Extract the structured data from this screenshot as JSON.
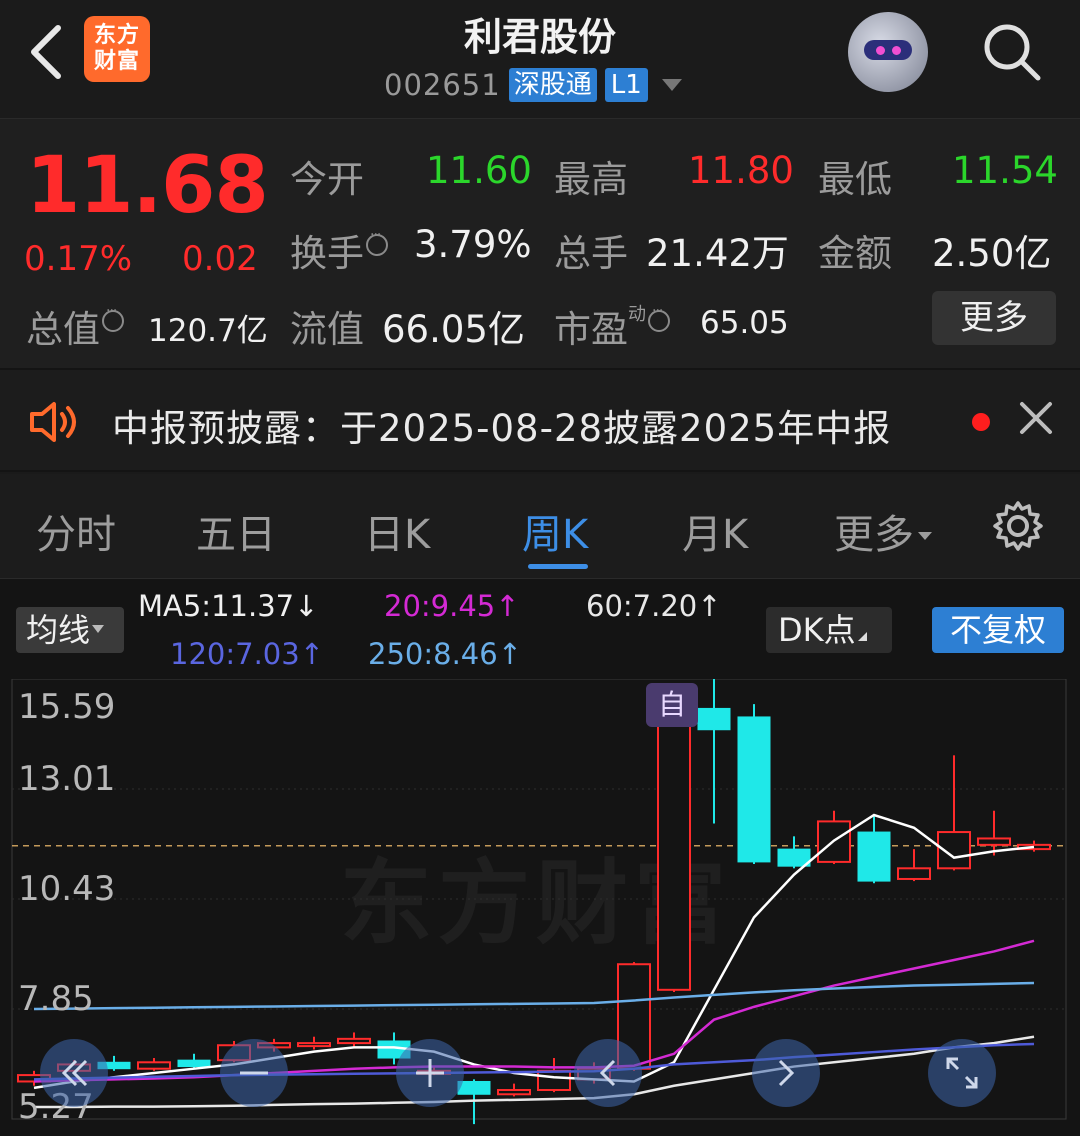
{
  "header": {
    "logo_text_line1": "东方",
    "logo_text_line2": "财富",
    "stock_name": "利君股份",
    "stock_code": "002651",
    "tag_connect": "深股通",
    "tag_level": "L1"
  },
  "quote": {
    "price": "11.68",
    "change_pct": "0.17%",
    "change_amt": "0.02",
    "open_label": "今开",
    "open_value": "11.60",
    "high_label": "最高",
    "high_value": "11.80",
    "low_label": "最低",
    "low_value": "11.54",
    "turnover_label": "换手",
    "turnover_value": "3.79%",
    "volume_label": "总手",
    "volume_value": "21.42万",
    "amount_label": "金额",
    "amount_value": "2.50亿",
    "mktcap_label": "总值",
    "mktcap_value": "120.7亿",
    "float_label": "流值",
    "float_value": "66.05亿",
    "pe_label": "市盈",
    "pe_sup": "动",
    "pe_value": "65.05",
    "more_label": "更多"
  },
  "notice": {
    "text": "中报预披露：于2025-08-28披露2025年中报"
  },
  "tabs": {
    "t1": "分时",
    "t2": "五日",
    "t3": "日K",
    "t4": "周K",
    "t5": "月K",
    "t6": "更多",
    "active": "周K"
  },
  "chart_controls": {
    "ma_button": "均线",
    "ma5": "MA5:11.37↓",
    "ma20": "20:9.45↑",
    "ma60": "60:7.20↑",
    "ma120": "120:7.03↑",
    "ma250": "250:8.46↑",
    "dk_button": "DK点",
    "adjust_button": "不复权",
    "self_marker": "自",
    "watermark": "东方财富"
  },
  "colors": {
    "up": "#ff2b2b",
    "down": "#1fe8e8",
    "ma5": "#ffffff",
    "ma20": "#d42ad4",
    "ma60": "#e8e8e8",
    "ma120": "#4e5ad8",
    "ma250": "#6aaee8",
    "accent": "#2d7fd3"
  },
  "chart_data": {
    "type": "candlestick",
    "y_ticks": [
      "15.59",
      "13.01",
      "10.43",
      "7.85",
      "5.27"
    ],
    "ylim": [
      5.27,
      15.59
    ],
    "current_price_line": 11.68,
    "candles": [
      {
        "o": 6.15,
        "c": 6.3,
        "h": 6.4,
        "l": 6.05
      },
      {
        "o": 6.4,
        "c": 6.55,
        "h": 6.65,
        "l": 6.35
      },
      {
        "o": 6.6,
        "c": 6.45,
        "h": 6.75,
        "l": 6.4
      },
      {
        "o": 6.45,
        "c": 6.6,
        "h": 6.7,
        "l": 6.4
      },
      {
        "o": 6.65,
        "c": 6.5,
        "h": 6.8,
        "l": 6.45
      },
      {
        "o": 6.65,
        "c": 7.0,
        "h": 7.1,
        "l": 6.6
      },
      {
        "o": 6.95,
        "c": 7.05,
        "h": 7.15,
        "l": 6.85
      },
      {
        "o": 7.0,
        "c": 7.05,
        "h": 7.2,
        "l": 6.9
      },
      {
        "o": 7.05,
        "c": 7.15,
        "h": 7.3,
        "l": 6.95
      },
      {
        "o": 7.1,
        "c": 6.7,
        "h": 7.3,
        "l": 6.55
      },
      {
        "o": 6.4,
        "c": 6.4,
        "h": 6.5,
        "l": 6.3
      },
      {
        "o": 6.15,
        "c": 5.85,
        "h": 6.2,
        "l": 5.15
      },
      {
        "o": 5.85,
        "c": 5.95,
        "h": 6.1,
        "l": 5.8
      },
      {
        "o": 5.95,
        "c": 6.4,
        "h": 6.7,
        "l": 5.9
      },
      {
        "o": 6.2,
        "c": 6.45,
        "h": 6.6,
        "l": 6.1
      },
      {
        "o": 6.45,
        "c": 8.9,
        "h": 8.95,
        "l": 6.4
      },
      {
        "o": 8.3,
        "c": 14.75,
        "h": 14.9,
        "l": 8.25
      },
      {
        "o": 14.9,
        "c": 14.4,
        "h": 15.6,
        "l": 12.2
      },
      {
        "o": 14.7,
        "c": 11.3,
        "h": 15.0,
        "l": 11.25
      },
      {
        "o": 11.6,
        "c": 11.2,
        "h": 11.9,
        "l": 11.15
      },
      {
        "o": 11.3,
        "c": 12.25,
        "h": 12.5,
        "l": 11.25
      },
      {
        "o": 12.0,
        "c": 10.85,
        "h": 12.4,
        "l": 10.8
      },
      {
        "o": 10.9,
        "c": 11.15,
        "h": 11.6,
        "l": 10.85
      },
      {
        "o": 11.15,
        "c": 12.0,
        "h": 13.8,
        "l": 11.1
      },
      {
        "o": 11.7,
        "c": 11.85,
        "h": 12.5,
        "l": 11.45
      },
      {
        "o": 11.6,
        "c": 11.7,
        "h": 11.8,
        "l": 11.54
      }
    ],
    "ma_series": [
      {
        "name": "MA5",
        "values": [
          6.0,
          6.15,
          6.25,
          6.35,
          6.45,
          6.55,
          6.7,
          6.85,
          6.95,
          6.95,
          6.85,
          6.55,
          6.35,
          6.25,
          6.2,
          6.15,
          6.6,
          8.3,
          10.0,
          11.0,
          11.8,
          12.4,
          12.1,
          11.4,
          11.55,
          11.65
        ]
      },
      {
        "name": "20",
        "values": [
          6.15,
          6.18,
          6.2,
          6.22,
          6.25,
          6.3,
          6.35,
          6.4,
          6.45,
          6.48,
          6.5,
          6.5,
          6.5,
          6.48,
          6.48,
          6.52,
          6.8,
          7.6,
          7.9,
          8.15,
          8.4,
          8.6,
          8.8,
          9.0,
          9.2,
          9.45
        ]
      },
      {
        "name": "60",
        "values": [
          5.55,
          5.55,
          5.56,
          5.56,
          5.57,
          5.58,
          5.6,
          5.62,
          5.63,
          5.65,
          5.67,
          5.7,
          5.72,
          5.74,
          5.76,
          5.85,
          6.05,
          6.2,
          6.35,
          6.5,
          6.6,
          6.7,
          6.8,
          6.95,
          7.05,
          7.2
        ]
      },
      {
        "name": "120",
        "values": [
          6.2,
          6.22,
          6.24,
          6.26,
          6.28,
          6.3,
          6.31,
          6.32,
          6.33,
          6.34,
          6.35,
          6.36,
          6.37,
          6.38,
          6.39,
          6.45,
          6.55,
          6.6,
          6.65,
          6.72,
          6.78,
          6.84,
          6.9,
          6.95,
          7.0,
          7.03
        ]
      },
      {
        "name": "250",
        "values": [
          7.85,
          7.86,
          7.87,
          7.88,
          7.89,
          7.9,
          7.91,
          7.92,
          7.93,
          7.94,
          7.95,
          7.96,
          7.97,
          7.98,
          7.99,
          8.05,
          8.12,
          8.18,
          8.24,
          8.29,
          8.33,
          8.37,
          8.4,
          8.42,
          8.44,
          8.46
        ]
      }
    ]
  }
}
